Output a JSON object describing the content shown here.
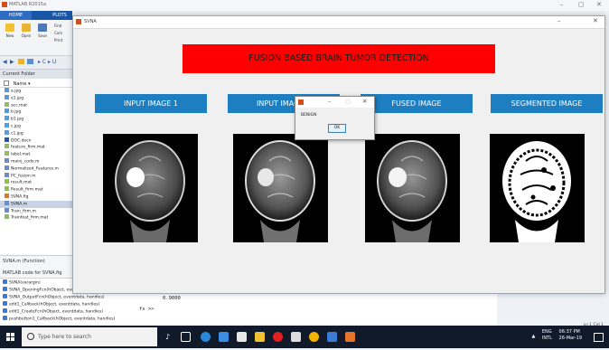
{
  "matlab": {
    "window_title": "MATLAB R2015a",
    "tabs": [
      "HOME",
      "PLOTS"
    ],
    "ribbon_buttons": [
      "New",
      "Open",
      "Save"
    ],
    "ribbon_side_items": [
      "Find",
      "Com",
      "Print"
    ],
    "current_folder_label": "Current Folder",
    "name_column": "Name",
    "files": [
      "a.jpg",
      "e1.jpg",
      "acc.mat",
      "b.jpg",
      "b1.jpg",
      "c.jpg",
      "c1.jpg",
      "DOC.docx",
      "feature_firm.mat",
      "label.mat",
      "mainj_code.m",
      "Normalized_Features.m",
      "PC_fusion.m",
      "result.mat",
      "Result_firm.mat",
      "SVNA.fig",
      "SVNA.m",
      "Train_firm.m",
      "Trainfeat_firm.mat"
    ],
    "selected_file": "SVNA.m",
    "details_title": "SVNA.m (Function)",
    "details_desc": "MATLAB code for SVNA.fig",
    "functions": [
      "SVNA(varargin)",
      "SVNA_OpeningFcn(hObject, eventdata, handles, varargin)",
      "SVNA_OutputFcn(hObject, eventdata, handles)",
      "edit1_Callback(hObject, eventdata, handles)",
      "edit1_CreateFcn(hObject, eventdata, handles)",
      "pushbutton1_Callback(hObject, eventdata, handles)"
    ],
    "command_value": "0.9000",
    "command_prompt": "fx >>",
    "status_position": "Ln 1   Col 1"
  },
  "figure": {
    "window_title": "SVNA",
    "banner": "FUSION BASED BRAIN TUMOR DETECTION",
    "labels": [
      "INPUT IMAGE 1",
      "INPUT IMAGE 2",
      "FUSED IMAGE",
      "SEGMENTED IMAGE"
    ]
  },
  "msgbox": {
    "message": "BENIGN",
    "ok_label": "OK"
  },
  "taskbar": {
    "search_placeholder": "Type here to search",
    "language": "ENG",
    "region": "INTL",
    "time": "06:37 PM",
    "date": "26-Mar-19"
  },
  "colors": {
    "banner": "#ff0000",
    "label_bg": "#1d7fc1",
    "matlab_tab": "#1a56a6",
    "taskbar": "#101a2b"
  }
}
